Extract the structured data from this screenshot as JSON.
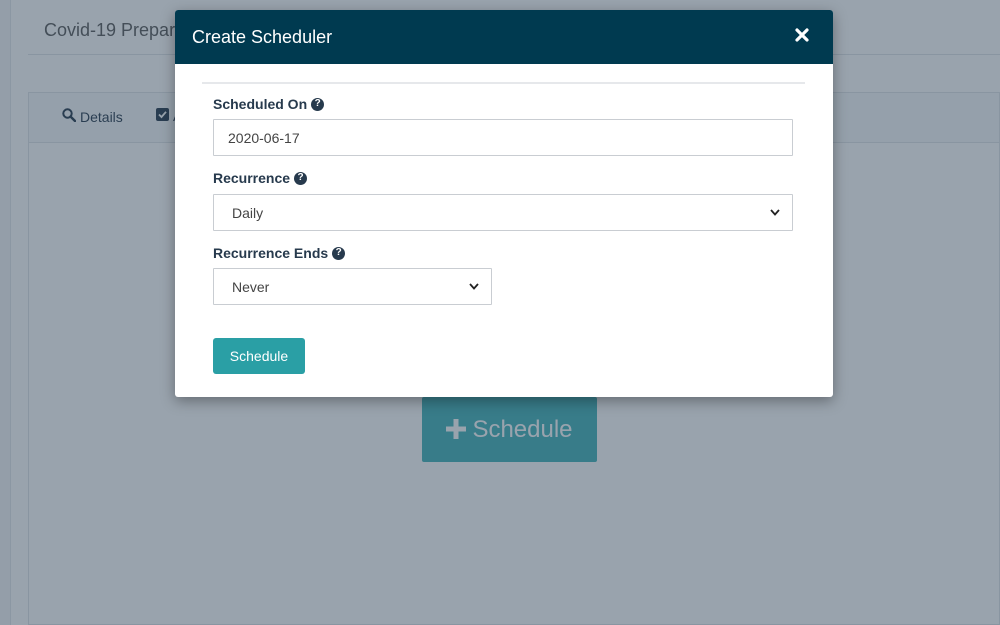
{
  "background": {
    "page_title": "Covid-19 Prepar",
    "tabs": [
      {
        "label": "Details",
        "icon": "search-icon"
      },
      {
        "label": "A",
        "icon": "checkbox-icon"
      }
    ],
    "schedule_button_label": "Schedule"
  },
  "modal": {
    "title": "Create Scheduler",
    "close_icon": "close-icon",
    "fields": {
      "scheduled_on": {
        "label": "Scheduled On",
        "value": "2020-06-17"
      },
      "recurrence": {
        "label": "Recurrence",
        "value": "Daily"
      },
      "recurrence_ends": {
        "label": "Recurrence Ends",
        "value": "Never"
      }
    },
    "submit_label": "Schedule"
  },
  "colors": {
    "header_bg": "#003a50",
    "accent": "#2a9fa5",
    "label_text": "#273a4d"
  }
}
